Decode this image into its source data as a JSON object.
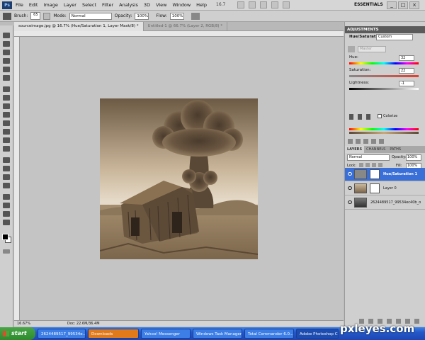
{
  "app": {
    "logo": "Ps"
  },
  "menu": [
    "File",
    "Edit",
    "Image",
    "Layer",
    "Select",
    "Filter",
    "Analysis",
    "3D",
    "View",
    "Window",
    "Help"
  ],
  "zoom_readout": "16.7",
  "workspace": "ESSENTIALS",
  "options_bar": {
    "brush_label": "Brush:",
    "brush_size": "65",
    "mode_label": "Mode:",
    "mode_value": "Normal",
    "opacity_label": "Opacity:",
    "opacity_value": "100%",
    "flow_label": "Flow:",
    "flow_value": "100%"
  },
  "doc_tabs": [
    {
      "label": "sourceimage.jpg @ 16.7% (Hue/Saturation 1, Layer Mask/8) *",
      "active": true
    },
    {
      "label": "Untitled-1 @ 66.7% (Layer 2, RGB/8) *",
      "active": false
    }
  ],
  "status": {
    "zoom": "16.67%",
    "doc": "Doc: 22.6M/36.4M"
  },
  "adjustments": {
    "title": "ADJUSTMENTS",
    "preset_label": "Hue/Saturation",
    "preset_value": "Custom",
    "channel": "Master",
    "hue_label": "Hue:",
    "hue_value": "32",
    "sat_label": "Saturation:",
    "sat_value": "22",
    "light_label": "Lightness:",
    "light_value": "-1",
    "colorize_label": "Colorize"
  },
  "layers_panel": {
    "tabs": [
      "LAYERS",
      "CHANNELS",
      "PATHS"
    ],
    "blend_mode": "Normal",
    "opacity_label": "Opacity:",
    "opacity_value": "100%",
    "lock_label": "Lock:",
    "fill_label": "Fill:",
    "fill_value": "100%",
    "layers": [
      {
        "name": "Hue/Saturation 1",
        "selected": true
      },
      {
        "name": "Layer 0",
        "selected": false
      },
      {
        "name": "2624489517_99534ec40b_o",
        "selected": false
      }
    ]
  },
  "taskbar": {
    "start": "start",
    "items": [
      "2624489517_99534e...",
      "Downloads",
      "Yahoo! Messenger",
      "Windows Task Manager",
      "Total Commander 6.0...",
      "Adobe Photoshop CS4"
    ]
  },
  "watermark": "pxleyes.com"
}
